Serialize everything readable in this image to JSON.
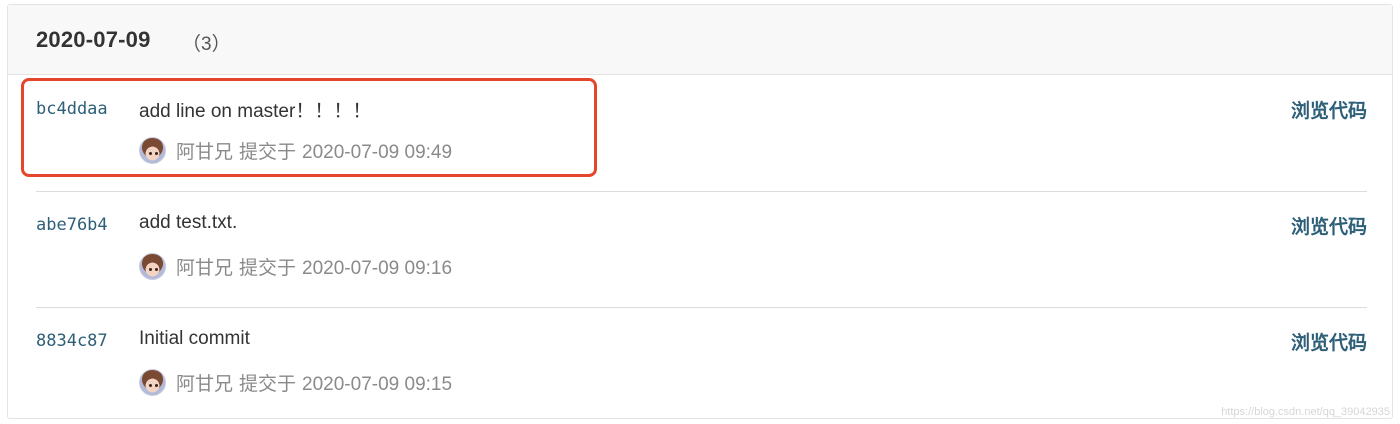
{
  "group": {
    "date": "2020-07-09",
    "count": "（3）"
  },
  "commits": [
    {
      "sha": "bc4ddaa",
      "message": "add line on master！！！！",
      "author": "阿甘兄",
      "action": "提交于",
      "timestamp": "2020-07-09 09:49",
      "browse_label": "浏览代码",
      "highlighted": true
    },
    {
      "sha": "abe76b4",
      "message": "add test.txt.",
      "author": "阿甘兄",
      "action": "提交于",
      "timestamp": "2020-07-09 09:16",
      "browse_label": "浏览代码",
      "highlighted": false
    },
    {
      "sha": "8834c87",
      "message": "Initial commit",
      "author": "阿甘兄",
      "action": "提交于",
      "timestamp": "2020-07-09 09:15",
      "browse_label": "浏览代码",
      "highlighted": false
    }
  ],
  "colors": {
    "link": "#2d5f78",
    "highlight_border": "#e5462b",
    "meta_text": "#8a8a8a"
  },
  "icons": {
    "avatar": "user-avatar"
  },
  "watermark": "https://blog.csdn.net/qq_39042935"
}
